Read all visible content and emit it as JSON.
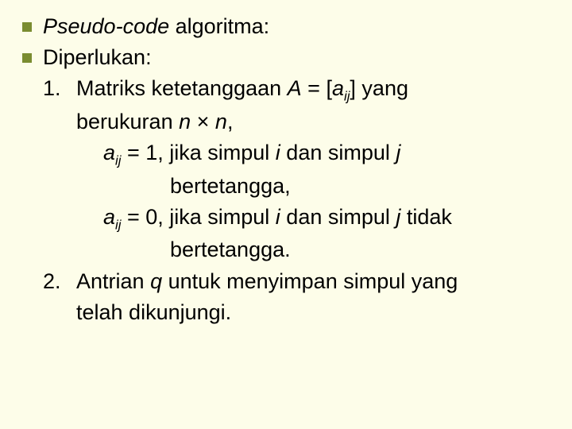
{
  "b1": {
    "pseudo": "Pseudo-code",
    "rest": " algoritma:"
  },
  "b2": {
    "title": "Diperlukan:",
    "item1": {
      "num": "1.",
      "t1a": "Matriks ketetanggaan ",
      "A": "A",
      "t1b": " = [",
      "a": "a",
      "ij": "ij",
      "t1c": "] yang",
      "t2a": "berukuran ",
      "n1": "n",
      "times": " × ",
      "n2": "n",
      "comma": ","
    },
    "cond1": {
      "a": "a",
      "ij": "ij",
      "eq": " = 1,  jika simpul ",
      "i": "i",
      "mid": " dan simpul ",
      "j": "j",
      "line2": "bertetangga,"
    },
    "cond2": {
      "a": "a",
      "ij": "ij",
      "eq": " = 0,   jika simpul ",
      "i": "i",
      "mid": " dan simpul ",
      "j": "j",
      "tail": " tidak",
      "line2": "bertetangga."
    },
    "item2": {
      "num": "2.",
      "t1a": "Antrian ",
      "q": "q",
      "t1b": " untuk menyimpan simpul yang",
      "t2": "telah dikunjungi."
    }
  }
}
